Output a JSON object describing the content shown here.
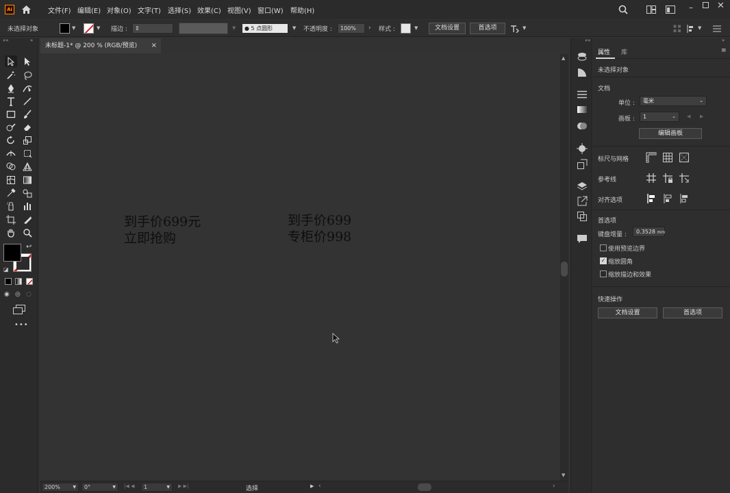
{
  "app": {
    "logo": "Ai",
    "menu": [
      "文件(F)",
      "编辑(E)",
      "对象(O)",
      "文字(T)",
      "选择(S)",
      "效果(C)",
      "视图(V)",
      "窗口(W)",
      "帮助(H)"
    ]
  },
  "control_bar": {
    "selection_state": "未选择对象",
    "stroke_label": "描边 :",
    "brush_size": "5",
    "brush_shape": "点圆形",
    "opacity_label": "不透明度 :",
    "opacity_value": "100%",
    "style_label": "样式 :",
    "doc_setup_btn": "文档设置",
    "prefs_btn": "首选项"
  },
  "document": {
    "tab_title": "未标题-1* @ 200 % (RGB/预览)",
    "close_glyph": "×"
  },
  "artwork": {
    "text_a_line1": "到手价699元",
    "text_a_line2": "立即抢购",
    "text_b_line1": "到手价699",
    "text_b_line2": "专柜价998"
  },
  "status_bar": {
    "zoom": "200%",
    "rotation": "0°",
    "artboard": "1",
    "tool": "选择"
  },
  "properties": {
    "tab_properties": "属性",
    "tab_library": "库",
    "no_selection": "未选择对象",
    "document_section": "文档",
    "units_label": "单位 :",
    "units_value": "毫米",
    "artboard_label": "画板 :",
    "artboard_value": "1",
    "edit_artboards_btn": "编辑画板",
    "rulers_grid": "标尺与网格",
    "guides": "参考线",
    "align_options": "对齐选项",
    "preferences_section": "首选项",
    "keyboard_increment_label": "键盘增量 :",
    "keyboard_increment_value": "0.3528",
    "keyboard_increment_unit": "mm",
    "use_preview_bounds": "使用预览边界",
    "scale_corners": "缩放圆角",
    "scale_strokes": "缩放描边和效果",
    "quick_actions": "快速操作",
    "doc_setup_btn": "文档设置",
    "prefs_btn": "首选项"
  },
  "colors": {
    "fill": "#000000",
    "ui_bg": "#323232",
    "accent_logo": "#ff9a00"
  }
}
